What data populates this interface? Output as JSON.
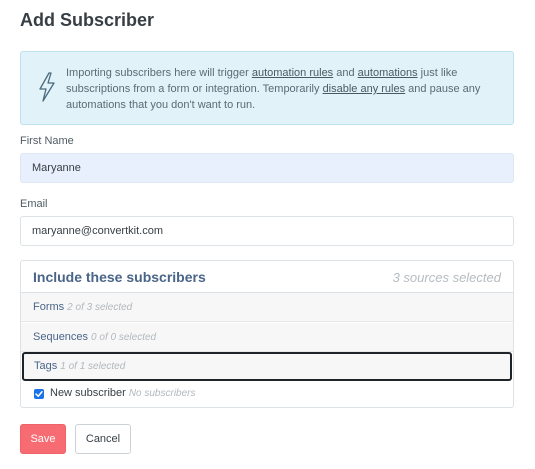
{
  "page": {
    "title": "Add Subscriber"
  },
  "notice": {
    "text_1": "Importing subscribers here will trigger ",
    "link_automation_rules": "automation rules",
    "text_2": " and ",
    "link_automations": "automations",
    "text_3": " just like subscriptions from a form or integration. Temporarily ",
    "link_disable_rules": "disable any rules",
    "text_4": " and pause any automations that you don't want to run.",
    "icon": "lightning-bolt-icon"
  },
  "fields": {
    "first_name": {
      "label": "First Name",
      "value": "Maryanne"
    },
    "email": {
      "label": "Email",
      "value": "maryanne@convertkit.com"
    }
  },
  "include": {
    "title": "Include these subscribers",
    "summary": "3 sources selected",
    "sources": [
      {
        "name": "Forms",
        "selected": "2 of 3 selected"
      },
      {
        "name": "Sequences",
        "selected": "0 of 0 selected"
      },
      {
        "name": "Tags",
        "selected": "1 of 1 selected"
      }
    ],
    "option": {
      "label": "New subscriber",
      "note": "No subscribers",
      "checked": true
    }
  },
  "buttons": {
    "save": "Save",
    "cancel": "Cancel"
  },
  "colors": {
    "save_button": "#f76b72",
    "link_blue": "#4a6589",
    "notice_bg": "#e1f2f9",
    "checkbox": "#1a73e8"
  }
}
